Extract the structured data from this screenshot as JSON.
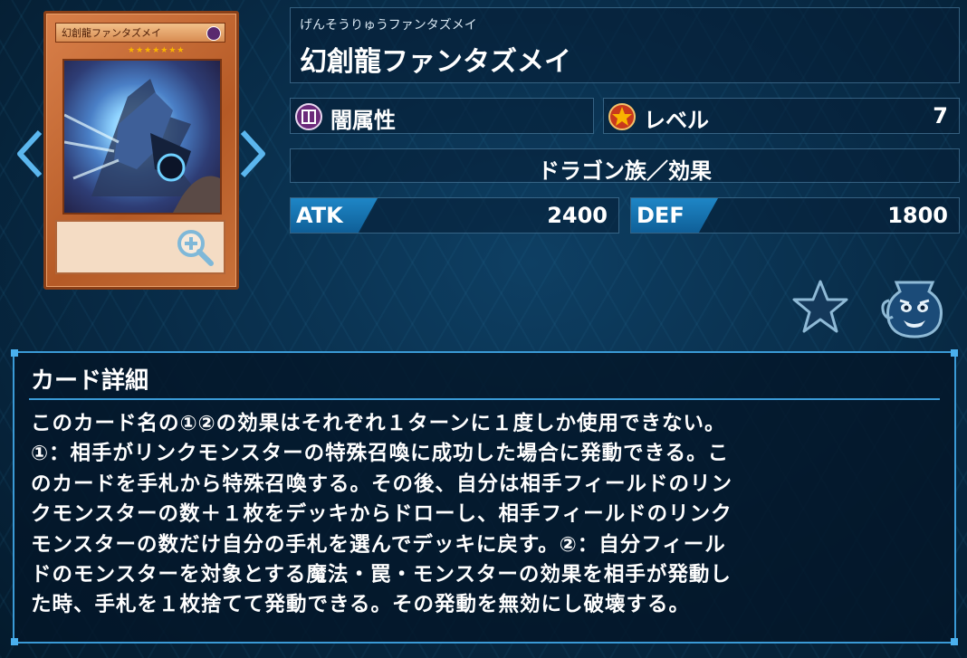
{
  "card": {
    "ruby": "げんそうりゅうファンタズメイ",
    "name": "幻創龍ファンタズメイ",
    "attribute": "闇属性",
    "attribute_icon": "dark-attribute-icon",
    "level_label": "レベル",
    "level": "7",
    "type": "ドラゴン族／効果",
    "atk_label": "ATK",
    "atk": "2400",
    "def_label": "DEF",
    "def": "1800",
    "stars": "★★★★★★★"
  },
  "detail": {
    "title": "カード詳細",
    "lines": [
      "このカード名の①②の効果はそれぞれ１ターンに１度しか使用できない。",
      "①：相手がリンクモンスターの特殊召喚に成功した場合に発動できる。こ",
      "のカードを手札から特殊召喚する。その後、自分は相手フィールドのリン",
      "クモンスターの数＋１枚をデッキからドローし、相手フィールドのリンク",
      "モンスターの数だけ自分の手札を選んでデッキに戻す。②：自分フィール",
      "ドのモンスターを対象とする魔法・罠・モンスターの効果を相手が発動し",
      "た時、手札を１枚捨てて発動できる。その発動を無効にし破壊する。"
    ]
  },
  "colors": {
    "accent": "#3a9ad6",
    "stat_tag": "#1e86c6",
    "card_frame": "#c8713a"
  },
  "icons": [
    "chevron-left-icon",
    "chevron-right-icon",
    "zoom-in-icon",
    "level-star-icon",
    "favorite-star-icon",
    "deck-pot-icon"
  ]
}
